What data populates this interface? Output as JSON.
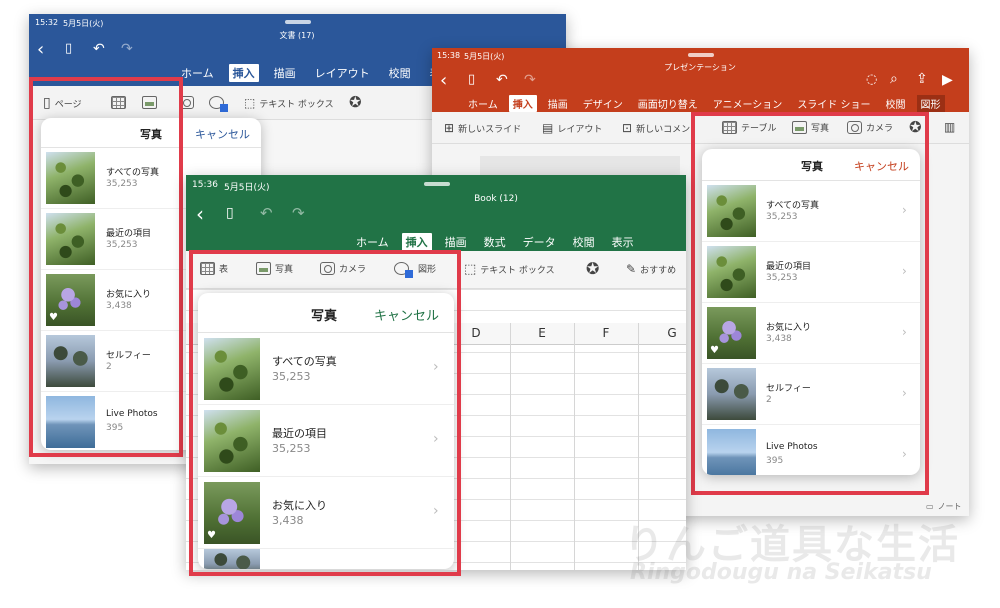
{
  "word": {
    "status_time": "15:32",
    "status_date": "5月5日(火)",
    "doc_title": "文書 (17)",
    "tabs": [
      "ホーム",
      "挿入",
      "描画",
      "レイアウト",
      "校閲",
      "表示"
    ],
    "active_tab": "挿入",
    "ribbon": {
      "page": "ページ",
      "textbox": "テキスト ボックス"
    },
    "picker": {
      "title": "写真",
      "cancel": "キャンセル"
    },
    "albums": [
      {
        "name": "すべての写真",
        "count": "35,253"
      },
      {
        "name": "最近の項目",
        "count": "35,253"
      },
      {
        "name": "お気に入り",
        "count": "3,438"
      },
      {
        "name": "セルフィー",
        "count": "2"
      },
      {
        "name": "Live Photos",
        "count": "395"
      }
    ]
  },
  "powerpoint": {
    "status_time": "15:38",
    "status_date": "5月5日(火)",
    "doc_title": "プレゼンテーション",
    "tabs": [
      "ホーム",
      "挿入",
      "描画",
      "デザイン",
      "画面切り替え",
      "アニメーション",
      "スライド ショー",
      "校閲",
      "図形"
    ],
    "active_tab": "挿入",
    "ribbon": {
      "new_slide": "新しいスライド",
      "layout": "レイアウト",
      "new_comment": "新しいコメン",
      "table": "テーブル",
      "photo": "写真",
      "camera": "カメラ"
    },
    "picker": {
      "title": "写真",
      "cancel": "キャンセル"
    },
    "albums": [
      {
        "name": "すべての写真",
        "count": "35,253"
      },
      {
        "name": "最近の項目",
        "count": "35,253"
      },
      {
        "name": "お気に入り",
        "count": "3,438"
      },
      {
        "name": "セルフィー",
        "count": "2"
      },
      {
        "name": "Live Photos",
        "count": "395"
      }
    ],
    "note": "ノート"
  },
  "excel": {
    "status_time": "15:36",
    "status_date": "5月5日(火)",
    "doc_title": "Book (12)",
    "tabs": [
      "ホーム",
      "挿入",
      "描画",
      "数式",
      "データ",
      "校閲",
      "表示"
    ],
    "active_tab": "挿入",
    "ribbon": {
      "table": "表",
      "photo": "写真",
      "camera": "カメラ",
      "shape": "図形",
      "textbox": "テキスト ボックス",
      "recommended": "おすすめ"
    },
    "picker": {
      "title": "写真",
      "cancel": "キャンセル"
    },
    "albums": [
      {
        "name": "すべての写真",
        "count": "35,253"
      },
      {
        "name": "最近の項目",
        "count": "35,253"
      },
      {
        "name": "お気に入り",
        "count": "3,438"
      }
    ],
    "columns": [
      "D",
      "E",
      "F",
      "G"
    ]
  },
  "watermark": {
    "line1": "りんご道具な生活",
    "line2": "Ringodougu na Seikatsu"
  },
  "colors": {
    "word": "#2b579a",
    "powerpoint": "#c43e1c",
    "excel": "#217346",
    "highlight": "#e03b4a",
    "cancel_word": "#2b579a",
    "cancel_ppt": "#c43e1c",
    "cancel_excel": "#217346"
  }
}
